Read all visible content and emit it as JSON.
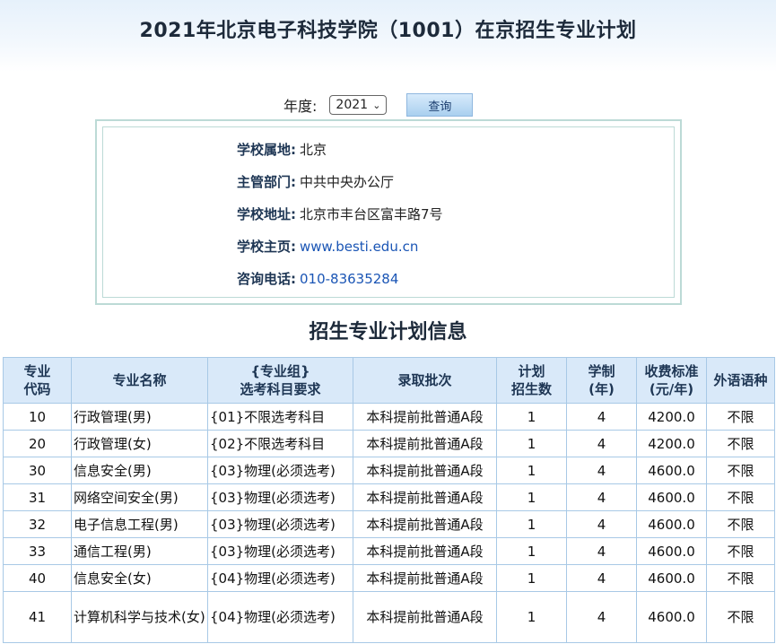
{
  "page": {
    "title": "2021年北京电子科技学院（1001）在京招生专业计划"
  },
  "filter": {
    "year_label": "年度:",
    "year_value": "2021",
    "query_label": "查询"
  },
  "school_info": [
    {
      "key": "学校属地:",
      "value": "北京",
      "link": false
    },
    {
      "key": "主管部门:",
      "value": "中共中央办公厅",
      "link": false
    },
    {
      "key": "学校地址:",
      "value": "北京市丰台区富丰路7号",
      "link": false
    },
    {
      "key": "学校主页:",
      "value": "www.besti.edu.cn",
      "link": true
    },
    {
      "key": "咨询电话:",
      "value": "010-83635284",
      "link": true
    }
  ],
  "section_title": "招生专业计划信息",
  "table": {
    "headers": [
      [
        "专业",
        "代码"
      ],
      [
        "专业名称"
      ],
      [
        "{专业组}",
        "选考科目要求"
      ],
      [
        "录取批次"
      ],
      [
        "计划",
        "招生数"
      ],
      [
        "学制",
        "(年)"
      ],
      [
        "收费标准",
        "(元/年)"
      ],
      [
        "外语语种"
      ]
    ],
    "rows": [
      [
        "10",
        "行政管理(男)",
        "{01}不限选考科目",
        "本科提前批普通A段",
        "1",
        "4",
        "4200.0",
        "不限"
      ],
      [
        "20",
        "行政管理(女)",
        "{02}不限选考科目",
        "本科提前批普通A段",
        "1",
        "4",
        "4200.0",
        "不限"
      ],
      [
        "30",
        "信息安全(男)",
        "{03}物理(必须选考)",
        "本科提前批普通A段",
        "1",
        "4",
        "4600.0",
        "不限"
      ],
      [
        "31",
        "网络空间安全(男)",
        "{03}物理(必须选考)",
        "本科提前批普通A段",
        "1",
        "4",
        "4600.0",
        "不限"
      ],
      [
        "32",
        "电子信息工程(男)",
        "{03}物理(必须选考)",
        "本科提前批普通A段",
        "1",
        "4",
        "4600.0",
        "不限"
      ],
      [
        "33",
        "通信工程(男)",
        "{03}物理(必须选考)",
        "本科提前批普通A段",
        "1",
        "4",
        "4600.0",
        "不限"
      ],
      [
        "40",
        "信息安全(女)",
        "{04}物理(必须选考)",
        "本科提前批普通A段",
        "1",
        "4",
        "4600.0",
        "不限"
      ],
      [
        "41",
        "计算机科学与技术(女)",
        "{04}物理(必须选考)",
        "本科提前批普通A段",
        "1",
        "4",
        "4600.0",
        "不限"
      ]
    ]
  },
  "colors": {
    "header_bg": "#d9e9f9",
    "border": "#a8c9e6",
    "link": "#1a55b5",
    "title": "#1d2a3a"
  }
}
